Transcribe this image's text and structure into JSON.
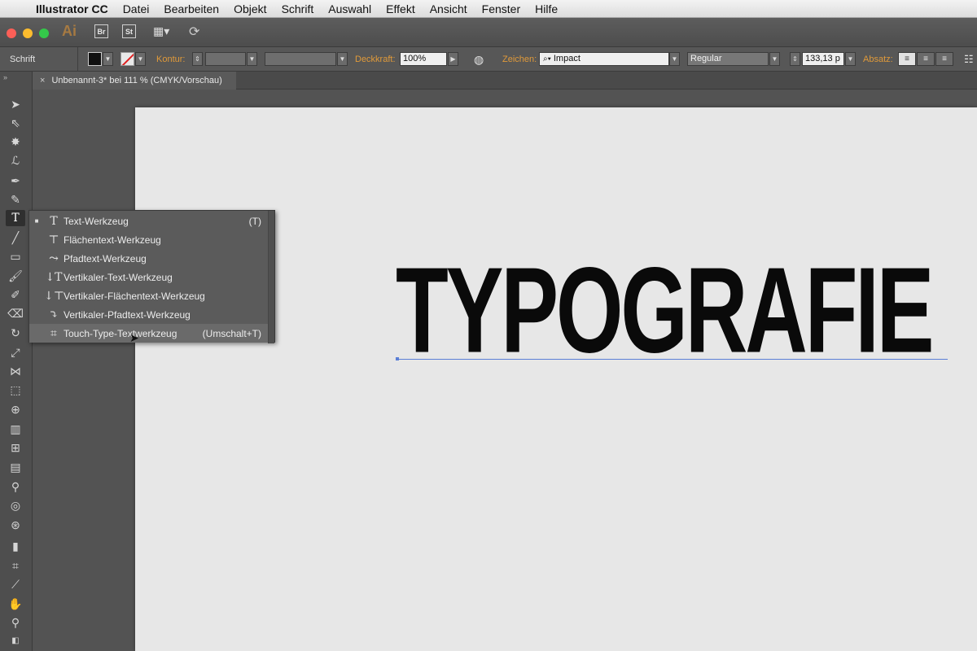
{
  "menubar": {
    "app_name": "Illustrator CC",
    "items": [
      "Datei",
      "Bearbeiten",
      "Objekt",
      "Schrift",
      "Auswahl",
      "Effekt",
      "Ansicht",
      "Fenster",
      "Hilfe"
    ]
  },
  "appbar": {
    "logo": "Ai",
    "bridge_label": "Br",
    "stock_label": "St"
  },
  "controlbar": {
    "context_label": "Schrift",
    "kontur_label": "Kontur:",
    "deckkraft_label": "Deckkraft:",
    "deckkraft_value": "100%",
    "zeichen_label": "Zeichen:",
    "font_family": "Impact",
    "font_style": "Regular",
    "font_size": "133,13 p",
    "absatz_label": "Absatz:"
  },
  "document": {
    "tab_title": "Unbenannt-3* bei 111 % (CMYK/Vorschau)",
    "headline": "TYPOGRAFIE"
  },
  "flyout": {
    "items": [
      {
        "label": "Text-Werkzeug",
        "shortcut": "(T)",
        "icon": "type-tool-icon",
        "selected": true
      },
      {
        "label": "Flächentext-Werkzeug",
        "shortcut": "",
        "icon": "area-type-tool-icon",
        "selected": false
      },
      {
        "label": "Pfadtext-Werkzeug",
        "shortcut": "",
        "icon": "type-on-path-tool-icon",
        "selected": false
      },
      {
        "label": "Vertikaler-Text-Werkzeug",
        "shortcut": "",
        "icon": "vertical-type-tool-icon",
        "selected": false
      },
      {
        "label": "Vertikaler-Flächentext-Werkzeug",
        "shortcut": "",
        "icon": "vertical-area-type-tool-icon",
        "selected": false
      },
      {
        "label": "Vertikaler-Pfadtext-Werkzeug",
        "shortcut": "",
        "icon": "vertical-type-on-path-tool-icon",
        "selected": false
      },
      {
        "label": "Touch-Type-Textwerkzeug",
        "shortcut": "(Umschalt+T)",
        "icon": "touch-type-tool-icon",
        "selected": false
      }
    ]
  },
  "colors": {
    "accent_label": "#e09a3a",
    "baseline": "#5b7fd6",
    "artboard": "#e7e7e7",
    "ui_dark": "#535353"
  }
}
